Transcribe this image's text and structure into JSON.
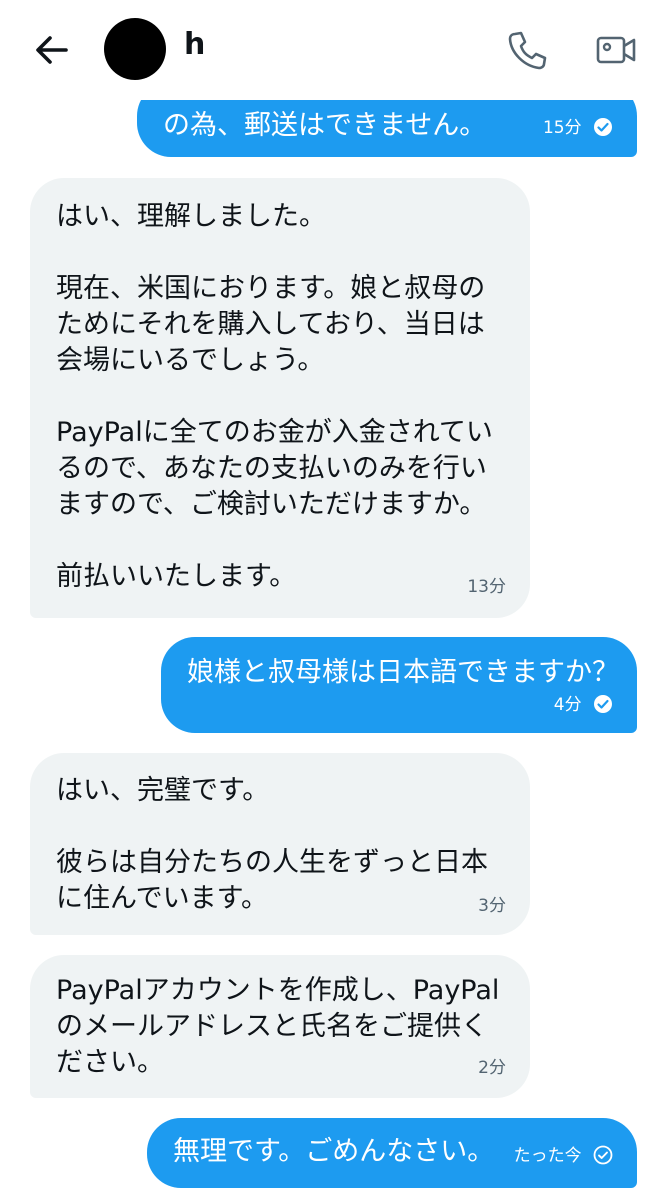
{
  "header": {
    "contact_name": "h"
  },
  "messages": [
    {
      "direction": "sent",
      "text": "の為、郵送はできません。",
      "time": "15分",
      "status": "read"
    },
    {
      "direction": "received",
      "text": "はい、理解しました。\n\n現在、米国におります。娘と叔母の\nためにそれを購入しており、当日は\n会場にいるでしょう。\n\nPayPalに全てのお金が入金されてい\nるので、あなたの支払いのみを行い\nますので、ご検討いただけますか。\n\n前払いいたします。",
      "time": "13分"
    },
    {
      "direction": "sent",
      "text": "娘様と叔母様は日本語できますか？",
      "time": "4分",
      "status": "read"
    },
    {
      "direction": "received",
      "text": "はい、完璧です。\n\n彼らは自分たちの人生をずっと日本\nに住んでいます。",
      "time": "3分"
    },
    {
      "direction": "received",
      "text": "PayPalアカウントを作成し、PayPal\nのメールアドレスと氏名をご提供く\nださい。",
      "time": "2分"
    },
    {
      "direction": "sent",
      "text": "無理です。ごめんなさい。",
      "time": "たった今",
      "status": "sent"
    }
  ],
  "colors": {
    "sent_bubble": "#1d9bf0",
    "received_bubble": "#eff3f4",
    "time_received": "#536471"
  },
  "icons": [
    "back-arrow-icon",
    "phone-icon",
    "video-camera-icon",
    "read-check-icon",
    "sent-check-icon"
  ]
}
